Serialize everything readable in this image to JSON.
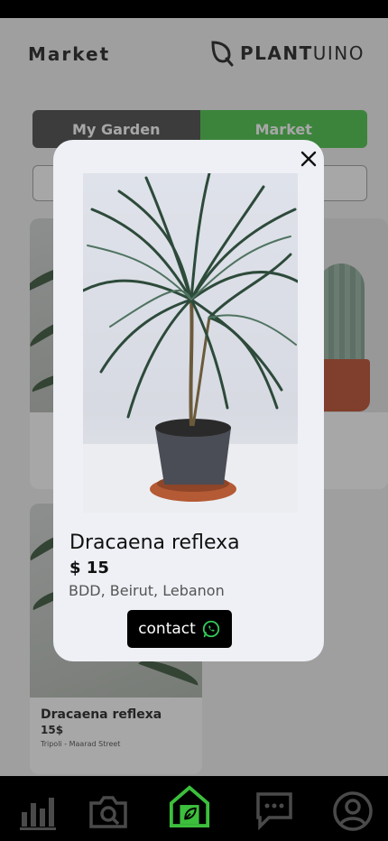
{
  "header": {
    "title": "Market",
    "logo_bold": "PLANT",
    "logo_light": "UINO"
  },
  "toggle": {
    "garden_label": "My Garden",
    "market_label": "Market"
  },
  "search": {
    "placeholder": ""
  },
  "background_cards": [
    {
      "name": "Dracaena reflexa",
      "price": "15$",
      "location": "Tripoli - Maarad Street"
    }
  ],
  "modal": {
    "name": "Dracaena reflexa",
    "price": "$ 15",
    "location": "BDD, Beirut, Lebanon",
    "contact_label": "contact"
  },
  "colors": {
    "accent": "#3cbf3c",
    "dark": "#3d3d3d",
    "nav_bg": "#000000",
    "modal_bg": "#eef0f5"
  },
  "icons": [
    "close-icon",
    "whatsapp-icon",
    "stats-icon",
    "camera-icon",
    "home-icon",
    "chat-icon",
    "profile-icon"
  ]
}
